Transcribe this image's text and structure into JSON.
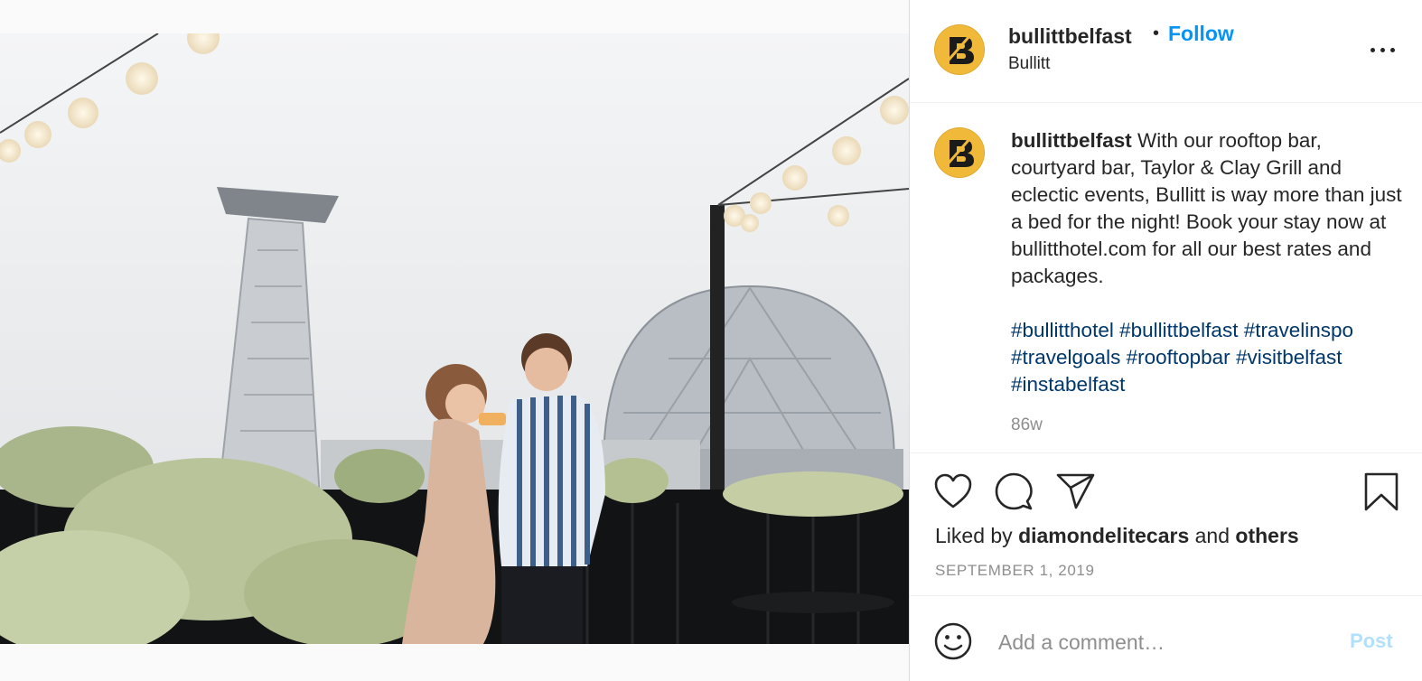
{
  "post": {
    "username": "bullittbelfast",
    "follow_label": "Follow",
    "dot": "•",
    "location": "Bullitt",
    "avatar_letter": "B",
    "caption_user": "bullittbelfast",
    "caption_text": "With our rooftop bar, courtyard bar, Taylor & Clay Grill and eclectic events, Bullitt is way more than just a bed for the night! Book your stay now at bullitthotel.com for all our best rates and packages.",
    "hashtags": [
      "#bullitthotel",
      "#bullittbelfast",
      "#travelinspo",
      "#travelgoals",
      "#rooftopbar",
      "#visitbelfast",
      "#instabelfast"
    ],
    "age": "86w",
    "liked_by_prefix": "Liked by",
    "liked_by_user": "diamondelitecars",
    "liked_by_and": "and",
    "liked_by_others": "others",
    "date": "SEPTEMBER 1, 2019"
  },
  "comment_box": {
    "placeholder": "Add a comment…",
    "post_label": "Post"
  },
  "icons": {
    "like": "heart-icon",
    "comment": "comment-icon",
    "share": "paper-plane-icon",
    "save": "bookmark-icon",
    "more": "more-options-icon",
    "emoji": "emoji-icon"
  },
  "colors": {
    "accent": "#0095f6",
    "hashtag": "#00376b",
    "muted": "#8e8e8e",
    "post_disabled": "#b2dffc",
    "avatar_bg": "#f0b93a"
  }
}
